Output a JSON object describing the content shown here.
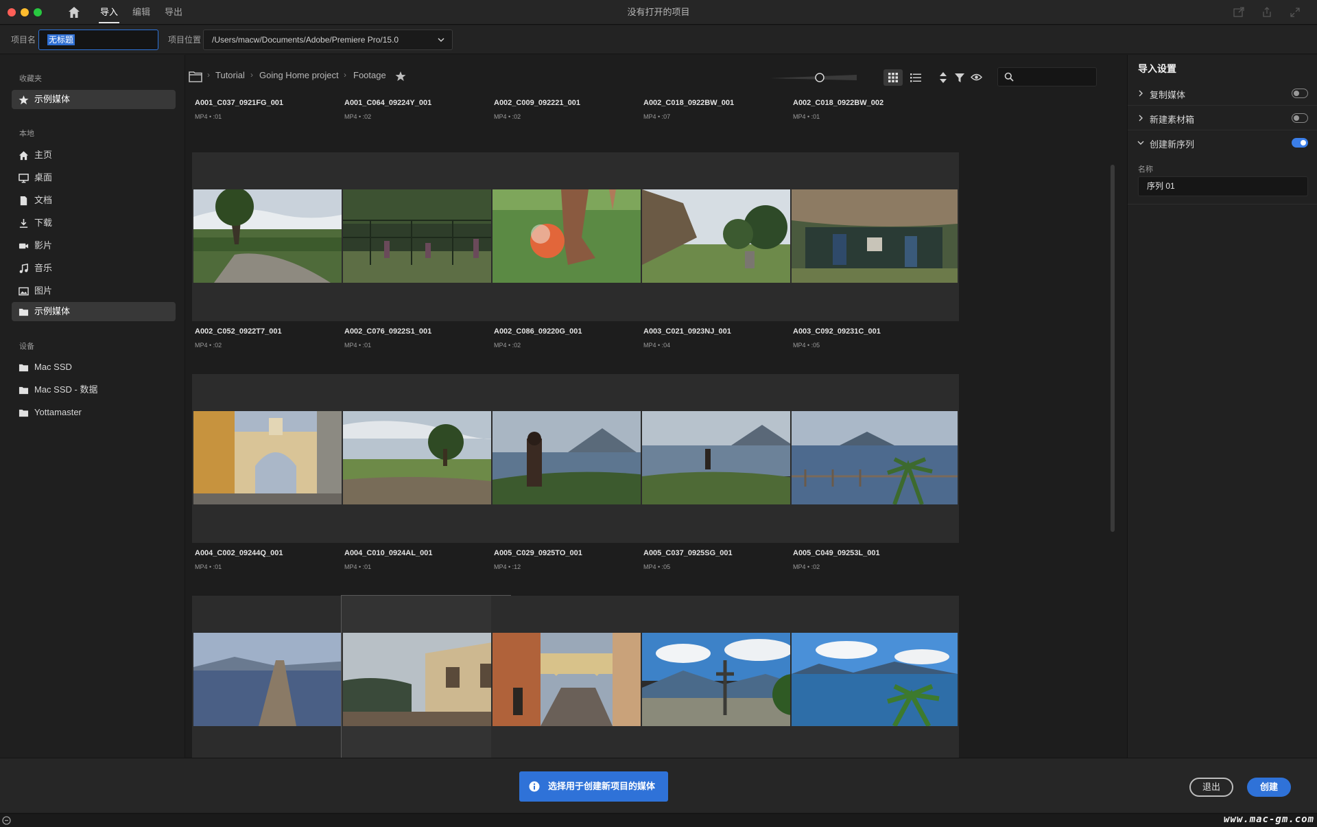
{
  "titlebar": {
    "nav": [
      "导入",
      "编辑",
      "导出"
    ],
    "window_title": "没有打开的项目"
  },
  "project_bar": {
    "name_label": "项目名",
    "name_value": "无标题",
    "location_label": "项目位置",
    "location_value": "/Users/macw/Documents/Adobe/Premiere Pro/15.0"
  },
  "sidebar": {
    "favorites_heading": "收藏夹",
    "favorites": [
      {
        "label": "示例媒体",
        "icon": "star-icon"
      }
    ],
    "local_heading": "本地",
    "local": [
      {
        "label": "主页",
        "icon": "home-icon"
      },
      {
        "label": "桌面",
        "icon": "desktop-icon"
      },
      {
        "label": "文档",
        "icon": "document-icon"
      },
      {
        "label": "下载",
        "icon": "download-icon"
      },
      {
        "label": "影片",
        "icon": "video-icon"
      },
      {
        "label": "音乐",
        "icon": "music-icon"
      },
      {
        "label": "图片",
        "icon": "image-icon"
      },
      {
        "label": "示例媒体",
        "icon": "folder-icon"
      }
    ],
    "devices_heading": "设备",
    "devices": [
      {
        "label": "Mac SSD",
        "icon": "folder-icon"
      },
      {
        "label": "Mac SSD - 数据",
        "icon": "folder-icon"
      },
      {
        "label": "Yottamaster",
        "icon": "folder-icon"
      }
    ]
  },
  "breadcrumb": [
    "Tutorial",
    "Going Home project",
    "Footage"
  ],
  "media": [
    {
      "name": "A001_C037_0921FG_001",
      "meta": "MP4 • :01"
    },
    {
      "name": "A001_C064_09224Y_001",
      "meta": "MP4 • :02"
    },
    {
      "name": "A002_C009_092221_001",
      "meta": "MP4 • :02"
    },
    {
      "name": "A002_C018_0922BW_001",
      "meta": "MP4 • :07"
    },
    {
      "name": "A002_C018_0922BW_002",
      "meta": "MP4 • :01"
    },
    {
      "name": "A002_C052_0922T7_001",
      "meta": "MP4 • :02"
    },
    {
      "name": "A002_C076_0922S1_001",
      "meta": "MP4 • :01"
    },
    {
      "name": "A002_C086_09220G_001",
      "meta": "MP4 • :02"
    },
    {
      "name": "A003_C021_0923NJ_001",
      "meta": "MP4 • :04"
    },
    {
      "name": "A003_C092_09231C_001",
      "meta": "MP4 • :05"
    },
    {
      "name": "A004_C002_09244Q_001",
      "meta": "MP4 • :01"
    },
    {
      "name": "A004_C010_0924AL_001",
      "meta": "MP4 • :01"
    },
    {
      "name": "A005_C029_0925TO_001",
      "meta": "MP4 • :12"
    },
    {
      "name": "A005_C037_0925SG_001",
      "meta": "MP4 • :05"
    },
    {
      "name": "A005_C049_09253L_001",
      "meta": "MP4 • :02"
    },
    {
      "name": "",
      "meta": ""
    },
    {
      "name": "",
      "meta": ""
    },
    {
      "name": "",
      "meta": ""
    },
    {
      "name": "",
      "meta": ""
    },
    {
      "name": "",
      "meta": ""
    }
  ],
  "right_panel": {
    "title": "导入设置",
    "rows": [
      {
        "label": "复制媒体",
        "on": false
      },
      {
        "label": "新建素材箱",
        "on": false
      },
      {
        "label": "创建新序列",
        "on": true
      }
    ],
    "name_label": "名称",
    "sequence_name": "序列 01"
  },
  "bottom": {
    "info_button": "选择用于创建新项目的媒体",
    "exit_button": "退出",
    "create_button": "创建"
  },
  "watermark": "www.mac-gm.com",
  "colors": {
    "accent": "#2f72d8",
    "background": "#1d1d1d",
    "panel": "#212121"
  }
}
